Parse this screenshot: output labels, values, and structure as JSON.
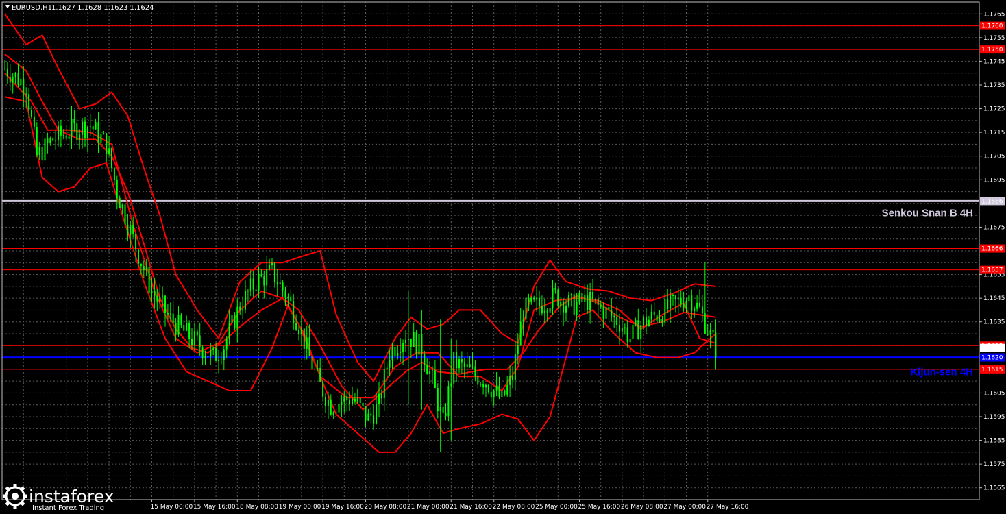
{
  "header": {
    "symbol": "EURUSD,H1",
    "ohlc": "1.1627 1.1628 1.1623 1.1624",
    "menu_icon": "triangle-down-icon"
  },
  "logo": {
    "brand": "instaforex",
    "tagline": "Instant Forex Trading",
    "icon": "gear-logo-icon"
  },
  "colors": {
    "background": "#000000",
    "grid": "#5a5a5a",
    "candles": "#00ff00",
    "indicators": "#ff0000",
    "levels": "#ff0000",
    "kijun": "#0000ff",
    "senkou": "#d0c8dc",
    "axis_text": "#ffffff"
  },
  "chart_data": {
    "type": "candlestick",
    "title": "EURUSD,H1",
    "ylim": [
      1.156,
      1.177
    ],
    "y_ticks": [
      "1.1765",
      "1.1755",
      "1.1745",
      "1.1735",
      "1.1725",
      "1.1715",
      "1.1705",
      "1.1695",
      "1.1675",
      "1.1655",
      "1.1645",
      "1.1635",
      "1.1605",
      "1.1595",
      "1.1585",
      "1.1575",
      "1.1565"
    ],
    "x_ticks": [
      {
        "label": "15 May 00:00",
        "bar": 55
      },
      {
        "label": "15 May 16:00",
        "bar": 71
      },
      {
        "label": "18 May 08:00",
        "bar": 87
      },
      {
        "label": "19 May 00:00",
        "bar": 103
      },
      {
        "label": "19 May 16:00",
        "bar": 119
      },
      {
        "label": "20 May 08:00",
        "bar": 135
      },
      {
        "label": "21 May 00:00",
        "bar": 151
      },
      {
        "label": "21 May 16:00",
        "bar": 167
      },
      {
        "label": "22 May 08:00",
        "bar": 183
      },
      {
        "label": "25 May 00:00",
        "bar": 199
      },
      {
        "label": "25 May 16:00",
        "bar": 215
      },
      {
        "label": "26 May 08:00",
        "bar": 231
      },
      {
        "label": "27 May 00:00",
        "bar": 247
      },
      {
        "label": "27 May 16:00",
        "bar": 263
      }
    ],
    "levels": [
      {
        "price": 1.176,
        "label": "1.1760",
        "kind": "resistance"
      },
      {
        "price": 1.175,
        "label": "1.1750",
        "kind": "resistance"
      },
      {
        "price": 1.1686,
        "label": "1.1686",
        "kind": "senkou"
      },
      {
        "price": 1.1666,
        "label": "1.1666",
        "kind": "resistance"
      },
      {
        "price": 1.1657,
        "label": "1.1657",
        "kind": "resistance"
      },
      {
        "price": 1.1625,
        "label": "1.1625",
        "kind": "support"
      },
      {
        "price": 1.162,
        "label": "1.1620",
        "kind": "kijun"
      },
      {
        "price": 1.1615,
        "label": "1.1615",
        "kind": "support"
      }
    ],
    "current_price": {
      "price": 1.1624,
      "label": "1.1624"
    },
    "annotations": [
      {
        "text": "Senkou Snan B 4H",
        "price": 1.1681,
        "color": "#d0c8dc"
      },
      {
        "text": "Kijun-sen 4H",
        "price": 1.1614,
        "color": "#0000ff"
      }
    ],
    "price_path": [
      [
        0,
        1.1742
      ],
      [
        8,
        1.1735
      ],
      [
        12,
        1.1705
      ],
      [
        18,
        1.1712
      ],
      [
        25,
        1.1716
      ],
      [
        32,
        1.1718
      ],
      [
        38,
        1.171
      ],
      [
        42,
        1.169
      ],
      [
        48,
        1.167
      ],
      [
        55,
        1.1648
      ],
      [
        62,
        1.1636
      ],
      [
        70,
        1.1628
      ],
      [
        78,
        1.162
      ],
      [
        82,
        1.1625
      ],
      [
        88,
        1.1642
      ],
      [
        94,
        1.1652
      ],
      [
        100,
        1.1656
      ],
      [
        106,
        1.1645
      ],
      [
        110,
        1.1634
      ],
      [
        114,
        1.162
      ],
      [
        118,
        1.1608
      ],
      [
        122,
        1.16
      ],
      [
        130,
        1.1603
      ],
      [
        136,
        1.1594
      ],
      [
        140,
        1.16
      ],
      [
        144,
        1.1622
      ],
      [
        150,
        1.163
      ],
      [
        156,
        1.1624
      ],
      [
        160,
        1.161
      ],
      [
        164,
        1.1592
      ],
      [
        168,
        1.1618
      ],
      [
        174,
        1.1614
      ],
      [
        180,
        1.161
      ],
      [
        186,
        1.1602
      ],
      [
        190,
        1.1612
      ],
      [
        194,
        1.164
      ],
      [
        200,
        1.1642
      ],
      [
        206,
        1.1646
      ],
      [
        212,
        1.1642
      ],
      [
        218,
        1.1644
      ],
      [
        224,
        1.164
      ],
      [
        230,
        1.1635
      ],
      [
        234,
        1.1628
      ],
      [
        238,
        1.1634
      ],
      [
        244,
        1.1638
      ],
      [
        250,
        1.1642
      ],
      [
        256,
        1.1646
      ],
      [
        260,
        1.164
      ],
      [
        266,
        1.1624
      ]
    ],
    "volatile_bars": [
      {
        "bar": 151,
        "high": 1.1648,
        "low": 1.16
      },
      {
        "bar": 156,
        "high": 1.164,
        "low": 1.1598
      },
      {
        "bar": 163,
        "high": 1.1636,
        "low": 1.158
      },
      {
        "bar": 167,
        "high": 1.1628,
        "low": 1.1585
      },
      {
        "bar": 262,
        "high": 1.166,
        "low": 1.1634
      }
    ],
    "indicator_paths": {
      "bb_upper": [
        [
          0,
          1.1765
        ],
        [
          8,
          1.1752
        ],
        [
          14,
          1.1756
        ],
        [
          20,
          1.1742
        ],
        [
          28,
          1.1725
        ],
        [
          34,
          1.1727
        ],
        [
          40,
          1.1732
        ],
        [
          46,
          1.1722
        ],
        [
          52,
          1.17
        ],
        [
          58,
          1.168
        ],
        [
          64,
          1.1655
        ],
        [
          72,
          1.164
        ],
        [
          80,
          1.1628
        ],
        [
          88,
          1.1652
        ],
        [
          96,
          1.166
        ],
        [
          104,
          1.166
        ],
        [
          112,
          1.1663
        ],
        [
          118,
          1.1665
        ],
        [
          124,
          1.1638
        ],
        [
          132,
          1.1618
        ],
        [
          138,
          1.161
        ],
        [
          146,
          1.1628
        ],
        [
          152,
          1.1637
        ],
        [
          158,
          1.1632
        ],
        [
          164,
          1.1634
        ],
        [
          170,
          1.164
        ],
        [
          178,
          1.164
        ],
        [
          186,
          1.163
        ],
        [
          192,
          1.1626
        ],
        [
          198,
          1.165
        ],
        [
          204,
          1.1661
        ],
        [
          210,
          1.1652
        ],
        [
          218,
          1.1649
        ],
        [
          226,
          1.1648
        ],
        [
          234,
          1.1645
        ],
        [
          242,
          1.1644
        ],
        [
          250,
          1.1647
        ],
        [
          258,
          1.1651
        ],
        [
          266,
          1.165
        ]
      ],
      "bb_lower": [
        [
          0,
          1.173
        ],
        [
          8,
          1.1728
        ],
        [
          14,
          1.1696
        ],
        [
          20,
          1.169
        ],
        [
          26,
          1.1692
        ],
        [
          32,
          1.17
        ],
        [
          38,
          1.1702
        ],
        [
          44,
          1.168
        ],
        [
          52,
          1.1652
        ],
        [
          60,
          1.1628
        ],
        [
          68,
          1.1614
        ],
        [
          76,
          1.161
        ],
        [
          84,
          1.1606
        ],
        [
          92,
          1.1606
        ],
        [
          100,
          1.1624
        ],
        [
          106,
          1.1642
        ],
        [
          112,
          1.163
        ],
        [
          118,
          1.1612
        ],
        [
          124,
          1.1596
        ],
        [
          132,
          1.1588
        ],
        [
          140,
          1.158
        ],
        [
          146,
          1.158
        ],
        [
          152,
          1.1588
        ],
        [
          158,
          1.16
        ],
        [
          164,
          1.1588
        ],
        [
          170,
          1.159
        ],
        [
          178,
          1.1592
        ],
        [
          186,
          1.1596
        ],
        [
          192,
          1.1594
        ],
        [
          198,
          1.1585
        ],
        [
          204,
          1.1595
        ],
        [
          210,
          1.162
        ],
        [
          214,
          1.1637
        ],
        [
          220,
          1.164
        ],
        [
          228,
          1.163
        ],
        [
          236,
          1.1622
        ],
        [
          244,
          1.162
        ],
        [
          252,
          1.162
        ],
        [
          258,
          1.1622
        ],
        [
          266,
          1.163
        ]
      ],
      "ma_mid": [
        [
          0,
          1.1748
        ],
        [
          8,
          1.1741
        ],
        [
          14,
          1.1728
        ],
        [
          20,
          1.1716
        ],
        [
          28,
          1.1712
        ],
        [
          34,
          1.1712
        ],
        [
          40,
          1.1705
        ],
        [
          46,
          1.169
        ],
        [
          52,
          1.1668
        ],
        [
          58,
          1.1645
        ],
        [
          64,
          1.1632
        ],
        [
          70,
          1.1624
        ],
        [
          76,
          1.1622
        ],
        [
          82,
          1.1627
        ],
        [
          88,
          1.1633
        ],
        [
          96,
          1.164
        ],
        [
          104,
          1.1645
        ],
        [
          110,
          1.164
        ],
        [
          118,
          1.1625
        ],
        [
          126,
          1.1608
        ],
        [
          134,
          1.1598
        ],
        [
          142,
          1.1606
        ],
        [
          150,
          1.1614
        ],
        [
          156,
          1.1618
        ],
        [
          162,
          1.1614
        ],
        [
          170,
          1.1613
        ],
        [
          180,
          1.1615
        ],
        [
          188,
          1.1615
        ],
        [
          194,
          1.1622
        ],
        [
          200,
          1.1632
        ],
        [
          208,
          1.1642
        ],
        [
          214,
          1.1646
        ],
        [
          222,
          1.1643
        ],
        [
          230,
          1.1637
        ],
        [
          238,
          1.1633
        ],
        [
          246,
          1.1635
        ],
        [
          254,
          1.1639
        ],
        [
          260,
          1.1638
        ],
        [
          266,
          1.1637
        ]
      ],
      "kijun_h1": [
        [
          0,
          1.174
        ],
        [
          10,
          1.1728
        ],
        [
          16,
          1.1716
        ],
        [
          24,
          1.1716
        ],
        [
          32,
          1.1715
        ],
        [
          40,
          1.171
        ],
        [
          48,
          1.1676
        ],
        [
          56,
          1.1648
        ],
        [
          64,
          1.1628
        ],
        [
          72,
          1.1622
        ],
        [
          80,
          1.1626
        ],
        [
          88,
          1.164
        ],
        [
          96,
          1.1648
        ],
        [
          104,
          1.1645
        ],
        [
          110,
          1.1634
        ],
        [
          118,
          1.1612
        ],
        [
          128,
          1.1603
        ],
        [
          138,
          1.1603
        ],
        [
          146,
          1.1616
        ],
        [
          154,
          1.1622
        ],
        [
          162,
          1.1622
        ],
        [
          170,
          1.1612
        ],
        [
          178,
          1.1612
        ],
        [
          186,
          1.1606
        ],
        [
          192,
          1.1616
        ],
        [
          198,
          1.164
        ],
        [
          206,
          1.1644
        ],
        [
          214,
          1.1645
        ],
        [
          222,
          1.1644
        ],
        [
          230,
          1.164
        ],
        [
          238,
          1.1632
        ],
        [
          246,
          1.1638
        ],
        [
          254,
          1.1643
        ],
        [
          260,
          1.1628
        ],
        [
          266,
          1.1626
        ]
      ]
    }
  }
}
